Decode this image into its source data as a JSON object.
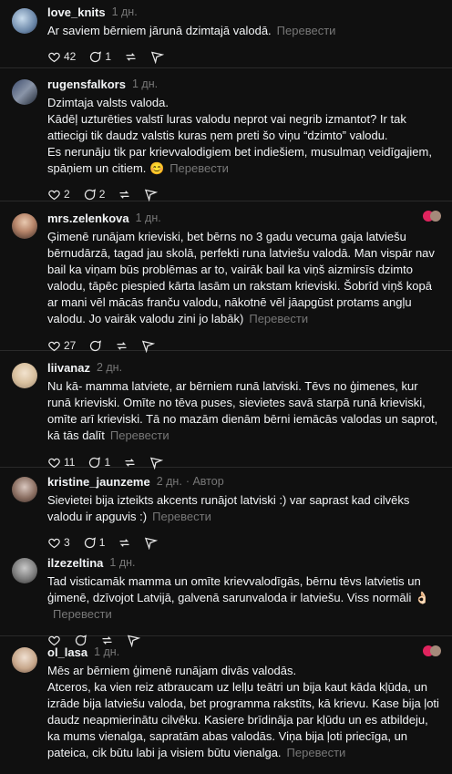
{
  "translate": "Перевести",
  "author_badge": "· Автор",
  "posts": [
    {
      "user": "love_knits",
      "time": "1 дн.",
      "text": "Ar saviem bērniem jārunā dzimtajā valodā.",
      "likes": "42",
      "replies": "1",
      "reposts": ""
    },
    {
      "user": "rugensfalkors",
      "time": "1 дн.",
      "text": "Dzimtaja valsts valoda.\nKādēļ uzturēties valstī luras valodu neprot vai negrib izmantot? Ir tak attiecigi tik daudz valstis kuras ņem preti šo viņu “dzimto” valodu.\nEs nerunāju tik par krievvalodigiem bet indiešiem, musulmaņ veidīgajiem, spāņiem un citiem. 😊",
      "likes": "2",
      "replies": "2",
      "reposts": ""
    },
    {
      "user": "mrs.zelenkova",
      "time": "1 дн.",
      "text": "Ģimenē runājam krieviski, bet bērns no 3 gadu vecuma gaja latviešu bērnudārzā, tagad jau skolā, perfekti runa latviešu valodā. Man vispār nav bail ka viņam būs problēmas ar to, vairāk bail ka viņš aizmirsīs dzimto valodu, tāpēc piespied kārta lasām un rakstam krieviski. Šobrīd viņš kopā ar mani vēl mācās franču valodu, nākotnē vēl jāapgūst protams angļu valodu. Jo vairāk valodu zini jo labāk)",
      "likes": "27",
      "replies": "",
      "reposts": ""
    },
    {
      "user": "liivanaz",
      "time": "2 дн.",
      "text": "Nu kā- mamma latviete, ar bērniem runā latviski. Tēvs no ģimenes, kur runā krieviski. Omīte no tēva puses, sievietes savā starpā runā krieviski, omīte arī krieviski. Tā no mazām dienām bērni iemācās valodas un saprot, kā tās dalīt",
      "likes": "11",
      "replies": "1",
      "reposts": ""
    },
    {
      "user": "kristine_jaunzeme",
      "time": "2 дн.",
      "text": "Sievietei bija izteikts akcents runājot latviski :) var saprast kad cilvēks valodu ir apguvis :)",
      "likes": "3",
      "replies": "1",
      "reposts": ""
    },
    {
      "user": "ilzezeltina",
      "time": "1 дн.",
      "text": "Tad visticamāk mamma un omīte krievvalodīgās, bērnu tēvs latvietis un ģimenē, dzīvojot Latvijā, galvenā sarunvaloda ir latviešu. Viss normāli 👌🏻",
      "likes": "",
      "replies": "",
      "reposts": ""
    },
    {
      "user": "ol_lasa",
      "time": "1 дн.",
      "text": "Mēs ar bērniem ģimenē runājam divās valodās.\nAtceros, ka vien reiz atbraucam uz lelļu teātri un bija kaut kāda kļūda, un izrāde bija latviešu valoda, bet programma rakstīts, kā krievu. Kase bija ļoti daudz neapmierinātu cilvēku. Kasiere brīdināja par kļūdu un es atbildeju, ka mums vienalga, sapratām abas valodās. Viņa bija ļoti priecīga, un pateica, cik būtu labi ja visiem būtu vienalga.",
      "likes": "",
      "replies": "",
      "reposts": ""
    }
  ]
}
